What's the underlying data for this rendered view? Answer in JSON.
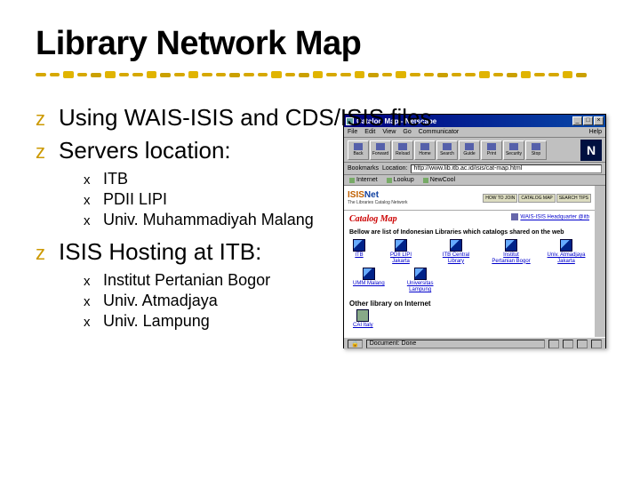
{
  "slide": {
    "title": "Library Network Map",
    "bullets": [
      {
        "text": "Using WAIS-ISIS and CDS/ISIS files"
      },
      {
        "text": "Servers location:",
        "sub": [
          "ITB",
          "PDII LIPI",
          "Univ. Muhammadiyah Malang"
        ]
      },
      {
        "text": "ISIS Hosting at ITB:",
        "sub": [
          "Institut Pertanian Bogor",
          "Univ. Atmadjaya",
          "Univ. Lampung"
        ]
      }
    ],
    "l1_bullet_glyph": "z",
    "l2_bullet_glyph": "x"
  },
  "browser": {
    "window_title": "Catalog Map - Netscape",
    "menus": [
      "File",
      "Edit",
      "View",
      "Go",
      "Communicator",
      "Help"
    ],
    "tool_buttons": [
      "Back",
      "Forward",
      "Reload",
      "Home",
      "Search",
      "Guide",
      "Print",
      "Security",
      "Stop"
    ],
    "logo_letter": "N",
    "location_label": "Bookmarks",
    "location_prefix": "Location:",
    "location_url": "http://www.lib.itb.ac.id/isis/cat-map.html",
    "link_toolbar": [
      "Internet",
      "Lookup",
      "NewCool"
    ],
    "page": {
      "brand": "ISISNet",
      "brand_sub": "The Libraries Catalog Network",
      "nav": [
        "HOW TO JOIN",
        "CATALOG MAP",
        "SEARCH TIPS"
      ],
      "heading": "Catalog Map",
      "hq_link": "WAIS-ISIS Headquarter @itb",
      "desc": "Bellow are list of Indonesian Libraries which catalogs shared on the web",
      "sites_row1": [
        {
          "label": "ITB"
        },
        {
          "label": "PDII LIPI Jakarta"
        },
        {
          "label": "ITB Central Library"
        },
        {
          "label": "Institut Pertanian Bogor"
        },
        {
          "label": "Univ. Atmadjaya Jakarta"
        }
      ],
      "sites_row2": [
        {
          "label": "UMM Malang"
        },
        {
          "label": "Universitas Lampung"
        }
      ],
      "subheading": "Other library on Internet",
      "other_sites": [
        {
          "label": "CAI Italy"
        }
      ]
    },
    "status": {
      "left": "Document: Done"
    }
  }
}
